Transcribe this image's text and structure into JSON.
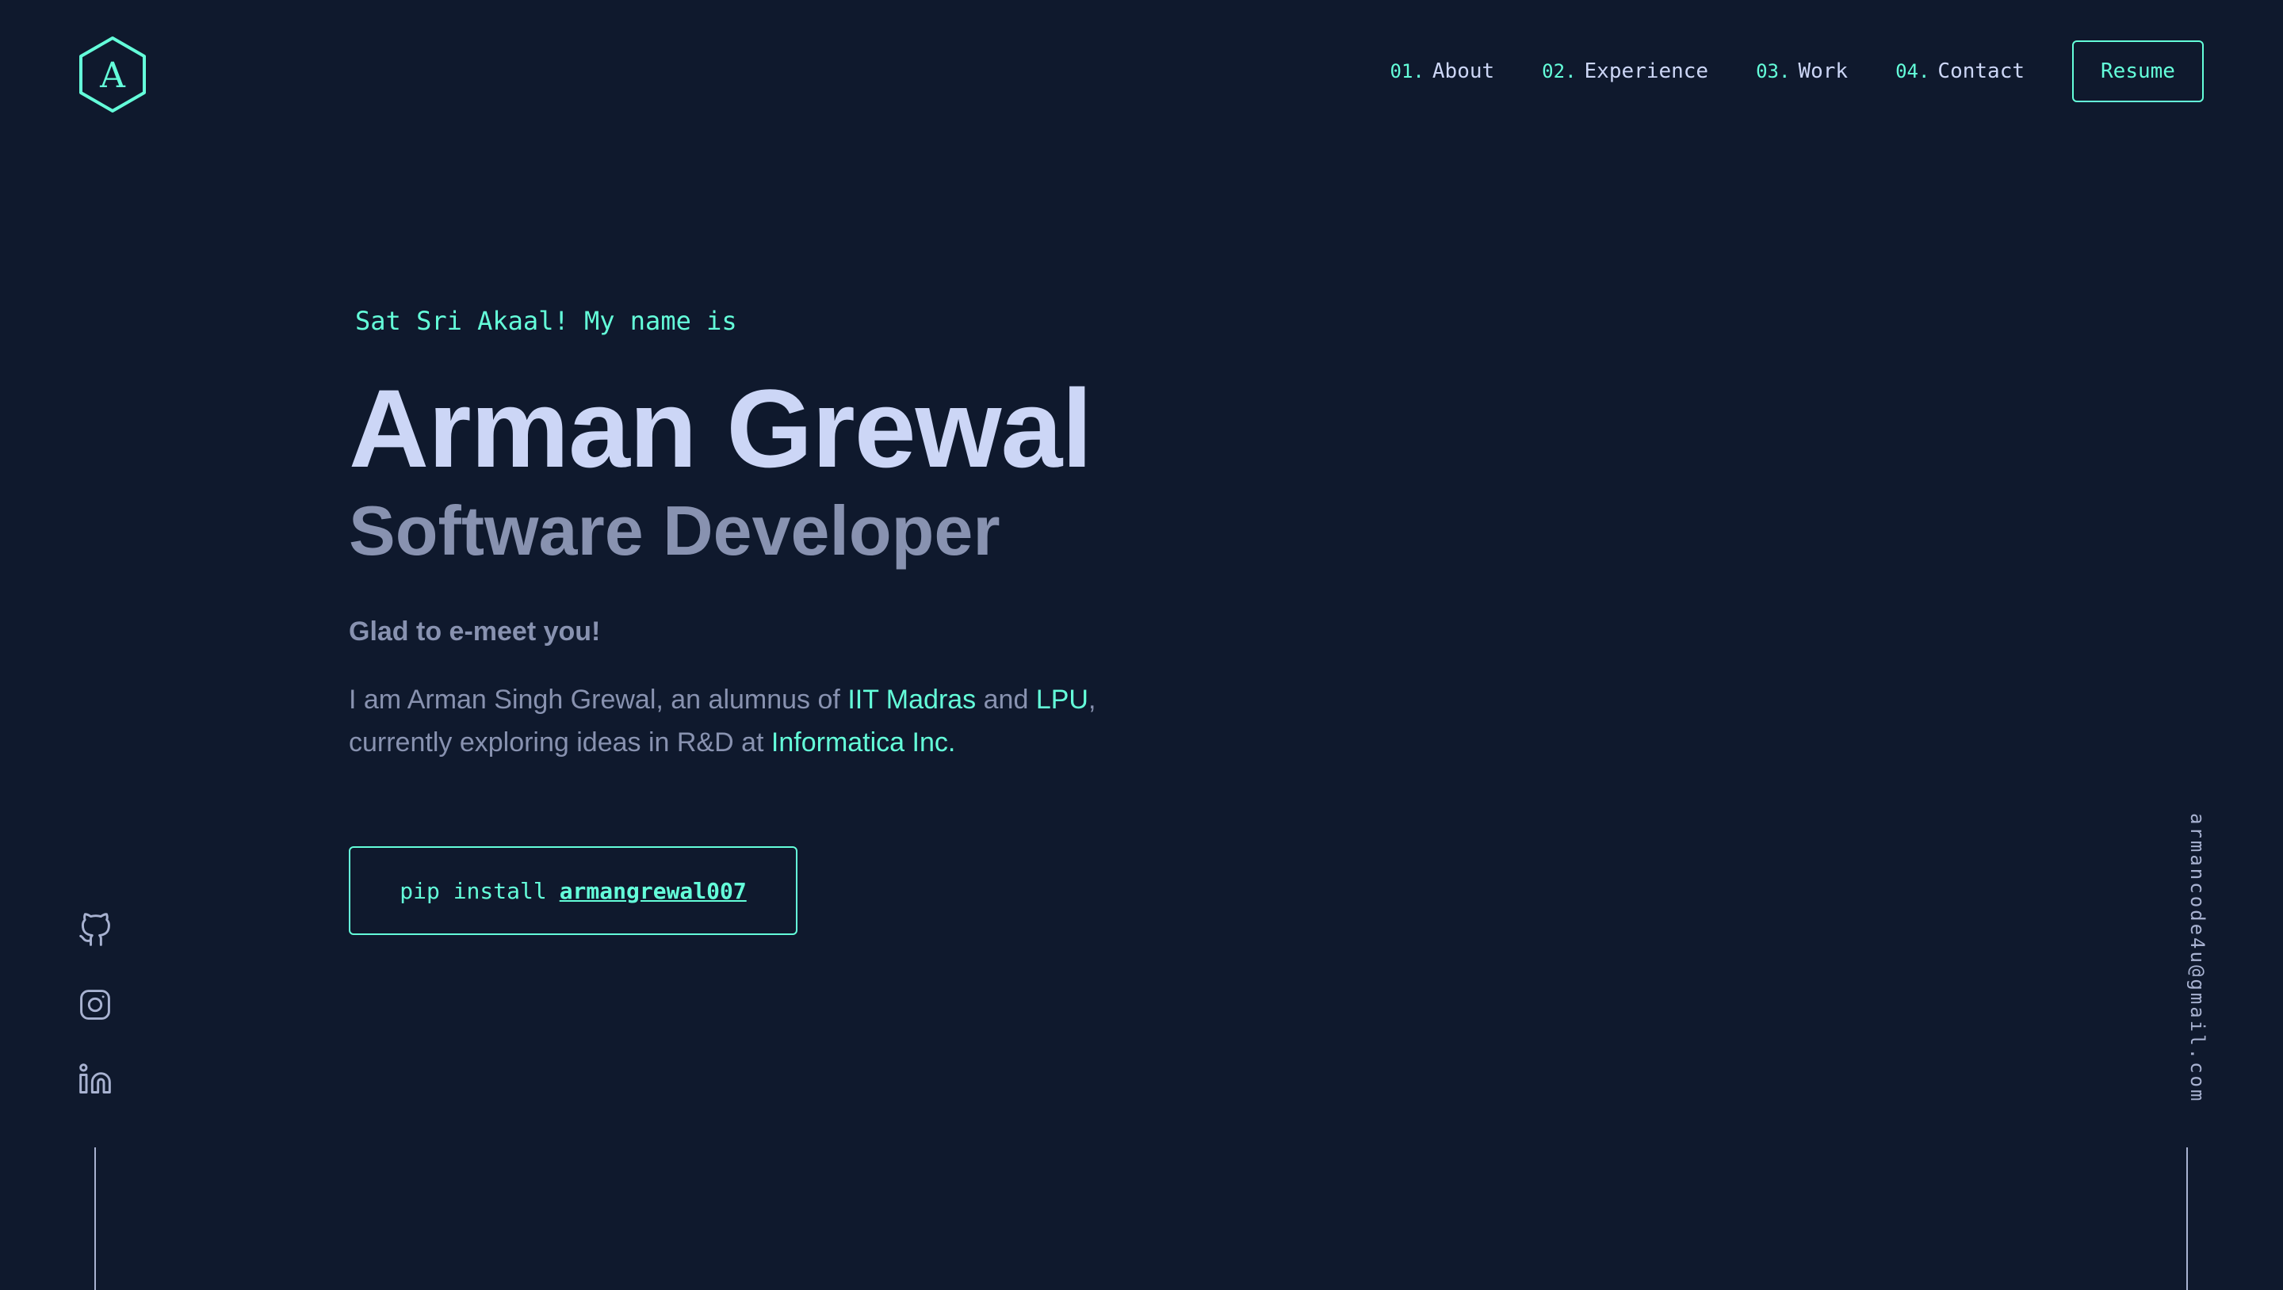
{
  "logo": {
    "letter": "A"
  },
  "nav": {
    "items": [
      {
        "num": "01.",
        "label": "About"
      },
      {
        "num": "02.",
        "label": "Experience"
      },
      {
        "num": "03.",
        "label": "Work"
      },
      {
        "num": "04.",
        "label": "Contact"
      }
    ],
    "resume_label": "Resume"
  },
  "hero": {
    "greeting": "Sat Sri Akaal! My name is",
    "name": "Arman Grewal",
    "role": "Software Developer",
    "glad": "Glad to e-meet you!",
    "bio": {
      "t1": "I am Arman Singh Grewal, an alumnus of ",
      "link1": "IIT Madras",
      "t2": " and ",
      "link2": "LPU",
      "t3": ", currently exploring ideas in R&D at ",
      "link3": "Informatica Inc."
    },
    "pip": {
      "command": "pip install",
      "package": "armangrewal007"
    }
  },
  "social": {
    "icons": [
      "github-icon",
      "instagram-icon",
      "linkedin-icon"
    ]
  },
  "email": "armancode4u@gmail.com",
  "colors": {
    "background": "#0f192d",
    "accent": "#64ffda",
    "heading": "#ccd6f6",
    "body": "#8892b0",
    "muted": "#a8b2d1"
  }
}
